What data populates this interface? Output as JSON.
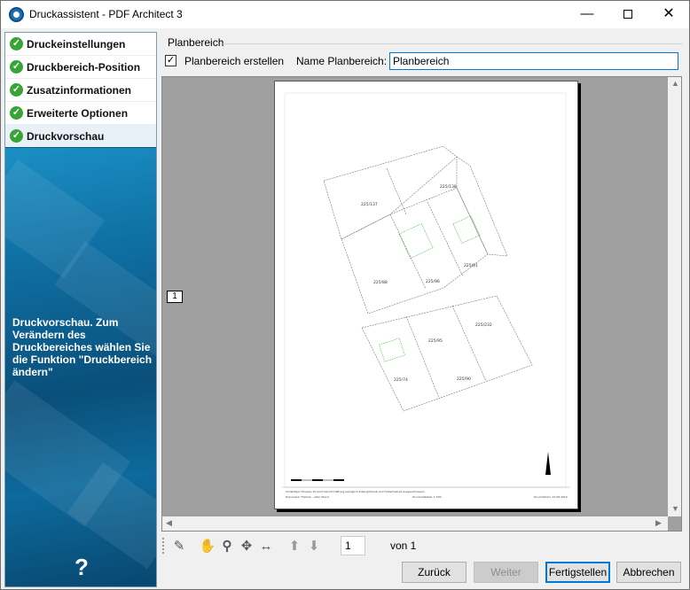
{
  "window": {
    "title": "Druckassistent - PDF Architect 3",
    "min_glyph": "—",
    "close_glyph": "✕"
  },
  "sidebar": {
    "items": [
      {
        "label": "Druckeinstellungen",
        "icon": "check-circle-icon"
      },
      {
        "label": "Druckbereich-Position",
        "icon": "check-circle-icon"
      },
      {
        "label": "Zusatzinformationen",
        "icon": "check-circle-icon"
      },
      {
        "label": "Erweiterte Optionen",
        "icon": "check-circle-icon"
      },
      {
        "label": "Druckvorschau",
        "icon": "check-circle-icon",
        "active": true
      }
    ],
    "description": "Druckvorschau. Zum Verändern des Druckbereiches wählen Sie die Funktion \"Druckbereich ändern\"",
    "help_glyph": "?"
  },
  "planbereich": {
    "group_title": "Planbereich",
    "checkbox_label": "Planbereich erstellen",
    "checked": true,
    "check_glyph": "✓",
    "name_label": "Name Planbereich:",
    "name_value": "Planbereich"
  },
  "preview": {
    "page_marker": "1",
    "parcels": [
      "225/137",
      "225/138",
      "225/88",
      "225/96",
      "225/91",
      "225/95",
      "225/232",
      "225/74",
      "225/90"
    ],
    "footer_left": "Vorläufiger Hinweis: Es wird hiermit Haftung bezüglich Zulänglichkeit und Fehlerfreiheit ausgeschlossen!",
    "footer_left2": "Dokument: Flächen - alter Stand",
    "footer_center": "Druckmaßstab: 1:500",
    "footer_right": "Druckdatum: 15.08.2019"
  },
  "toolbar": {
    "tools": [
      "pencil-icon",
      "hand-icon",
      "zoom-icon",
      "move-icon",
      "fit-width-icon",
      "arrow-up-icon",
      "arrow-down-icon"
    ],
    "page_value": "1",
    "von_label": "von 1"
  },
  "buttons": {
    "back": "Zurück",
    "next": "Weiter",
    "finish": "Fertigstellen",
    "cancel": "Abbrechen"
  },
  "colors": {
    "sidebar_bg": "#0d5b85",
    "check_green": "#36a536",
    "accent": "#0078d7"
  }
}
